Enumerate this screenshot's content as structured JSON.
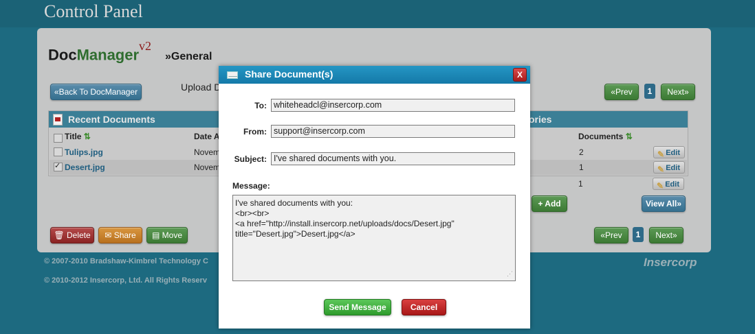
{
  "header": {
    "title": "Control Panel"
  },
  "app": {
    "logo_doc": "Doc",
    "logo_manager": "Manager",
    "logo_version": "v2",
    "section": "»General"
  },
  "toolbar": {
    "back_label": "«Back To DocManager",
    "upload_text": "Upload D",
    "prev_label": "«Prev",
    "page": "1",
    "next_label": "Next»"
  },
  "documents": {
    "header": "Recent Documents",
    "header_right": "ories",
    "columns": {
      "title": "Title",
      "date": "Date A",
      "documents": "Documents"
    },
    "rows": [
      {
        "title": "Tulips.jpg",
        "date": "Novem",
        "checked": false,
        "count": "2"
      },
      {
        "title": "Desert.jpg",
        "date": "Novem",
        "checked": true,
        "count": "1"
      },
      {
        "title": "",
        "date": "",
        "checked": false,
        "count": "1"
      }
    ],
    "edit_label": "Edit",
    "add_label": "+ Add",
    "view_all_label": "View All»"
  },
  "actions": {
    "delete": "Delete",
    "share": "Share",
    "move": "Move"
  },
  "footer": {
    "line1": "© 2007-2010 Bradshaw-Kimbrel Technology C",
    "line2": "© 2010-2012 Insercorp, Ltd. All Rights Reserv",
    "brand": "Insercorp"
  },
  "modal": {
    "title": "Share Document(s)",
    "close": "X",
    "to_label": "To:",
    "to_value": "whiteheadcl@insercorp.com",
    "from_label": "From:",
    "from_value": "support@insercorp.com",
    "subject_label": "Subject:",
    "subject_value": "I've shared documents with you.",
    "message_label": "Message:",
    "message_value": "I've shared documents with you:\n<br><br>\n<a href=\"http://install.insercorp.net/uploads/docs/Desert.jpg\"\ntitle=\"Desert.jpg\">Desert.jpg</a>",
    "send_label": "Send Message",
    "cancel_label": "Cancel"
  },
  "colors": {
    "background": "#1d6a80",
    "modal_header": "#1a86b6",
    "send": "#3aa838",
    "cancel": "#b52222"
  }
}
